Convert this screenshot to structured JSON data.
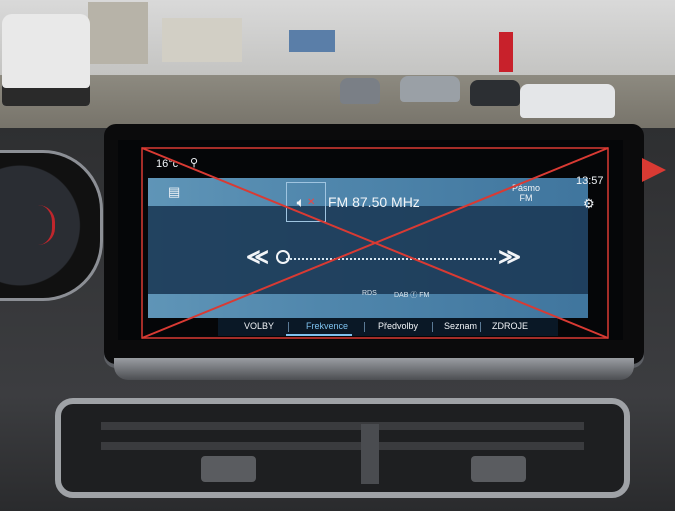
{
  "status": {
    "temperature": "16°c",
    "time": "13:57"
  },
  "radio": {
    "station": "FM 87.50 MHz",
    "band_label": "Pásmo",
    "band_value": "FM",
    "rds_label": "RDS",
    "dab_label": "DAB ⓕ FM",
    "prev_icon": "rewind-icon",
    "next_icon": "fast-forward-icon",
    "mute_icon": "speaker-muted-icon"
  },
  "tabs": [
    {
      "label": "VOLBY"
    },
    {
      "label": "Frekvence"
    },
    {
      "label": "Předvolby"
    },
    {
      "label": "Seznam"
    },
    {
      "label": "ZDROJE"
    }
  ],
  "colors": {
    "accent": "#7ec2ef",
    "panel": "#5d9dc9",
    "overlay_red": "#d93a33"
  }
}
